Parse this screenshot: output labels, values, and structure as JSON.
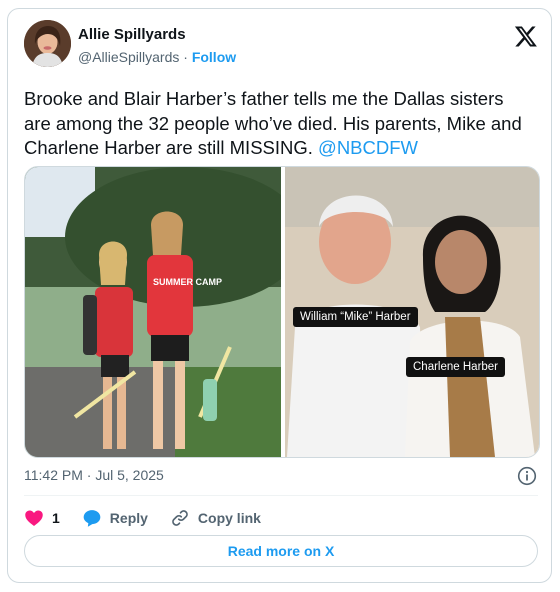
{
  "author": {
    "name": "Allie Spillyards",
    "handle": "@AllieSpillyards",
    "separator": "·",
    "follow_label": "Follow"
  },
  "tweet": {
    "text": "Brooke and Blair Harber’s father tells me the Dallas sisters are among the 32 people who’ve died. His parents, Mike and Charlene Harber are still MISSING. ",
    "mention": "@NBCDFW"
  },
  "media": {
    "left_photo_shirt_text": "SUMMER CAMP",
    "right_photo_labels": [
      "William “Mike” Harber",
      "Charlene Harber"
    ]
  },
  "timestamp": "11:42 PM · Jul 5, 2025",
  "actions": {
    "like_count": "1",
    "reply_label": "Reply",
    "copy_link_label": "Copy link"
  },
  "read_more_label": "Read more on X",
  "icons": {
    "logo": "x-logo-icon",
    "info": "info-icon",
    "like": "heart-icon",
    "reply": "reply-bubble-icon",
    "copy": "link-icon"
  },
  "colors": {
    "accent": "#1d9bf0",
    "like": "#f91880",
    "muted": "#536471"
  }
}
